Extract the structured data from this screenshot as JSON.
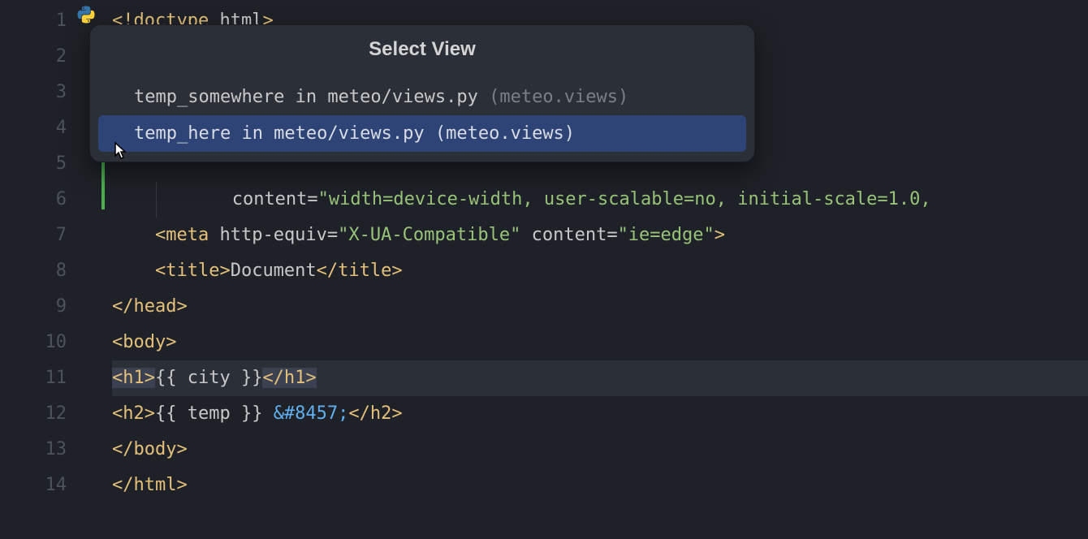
{
  "popup": {
    "title": "Select View",
    "items": [
      {
        "label": "temp_somewhere in meteo/views.py",
        "dim": " (meteo.views)",
        "selected": false
      },
      {
        "label": "temp_here in meteo/views.py (meteo.views)",
        "dim": "",
        "selected": true
      }
    ]
  },
  "gutter": {
    "lines": [
      "1",
      "2",
      "3",
      "4",
      "5",
      "6",
      "7",
      "8",
      "9",
      "10",
      "11",
      "12",
      "13",
      "14"
    ]
  },
  "code": {
    "l1_tag": "<!doctype ",
    "l1_attr": "html",
    "l1_end": ">",
    "l6_attr": "content",
    "l6_eq": "=",
    "l6_str": "\"width=device-width, user-scalable=no, initial-scale=1.0,",
    "l7_open": "<meta ",
    "l7_a1": "http-equiv",
    "l7_eq": "=",
    "l7_s1": "\"X-UA-Compatible\"",
    "l7_sp": " ",
    "l7_a2": "content",
    "l7_s2": "\"ie=edge\"",
    "l7_close": ">",
    "l8_open": "<title>",
    "l8_txt": "Document",
    "l8_close": "</title>",
    "l9": "</head>",
    "l10": "<body>",
    "l11_open": "<h1>",
    "l11_tmpl": "{{ city }}",
    "l11_close": "</h1>",
    "l12_open": "<h2>",
    "l12_tmpl": "{{ temp }}",
    "l12_sp": " ",
    "l12_ent": "&#8457;",
    "l12_close": "</h2>",
    "l13": "</body>",
    "l14": "</html>"
  }
}
